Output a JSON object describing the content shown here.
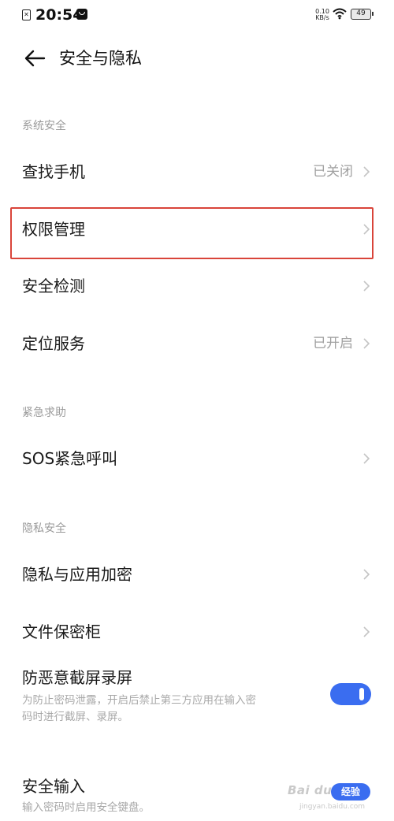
{
  "status_bar": {
    "time": "20:54",
    "net_speed_value": "0.10",
    "net_speed_unit": "KB/s",
    "battery": "49"
  },
  "header": {
    "title": "安全与隐私"
  },
  "sections": {
    "system_security": "系统安全",
    "emergency": "紧急求助",
    "privacy": "隐私安全"
  },
  "rows": {
    "find_phone": {
      "label": "查找手机",
      "value": "已关闭"
    },
    "permissions": {
      "label": "权限管理"
    },
    "security_check": {
      "label": "安全检测"
    },
    "location": {
      "label": "定位服务",
      "value": "已开启"
    },
    "sos": {
      "label": "SOS紧急呼叫"
    },
    "privacy_encrypt": {
      "label": "隐私与应用加密"
    },
    "file_safe": {
      "label": "文件保密柜"
    },
    "anti_screenshot": {
      "label": "防恶意截屏录屏",
      "desc_line1": "为防止密码泄露，开启后禁止第三方应用在输入密",
      "desc_line2": "码时进行截屏、录屏。",
      "toggle_on": true
    },
    "secure_input": {
      "label": "安全输入",
      "desc": "输入密码时启用安全键盘。"
    }
  },
  "watermark": {
    "brand": "Bai du",
    "pill": "经验",
    "sub": "jingyan.baidu.com"
  },
  "colors": {
    "accent": "#3a6df0",
    "highlight_border": "#d9443a",
    "secondary_text": "#a0a0a0"
  }
}
